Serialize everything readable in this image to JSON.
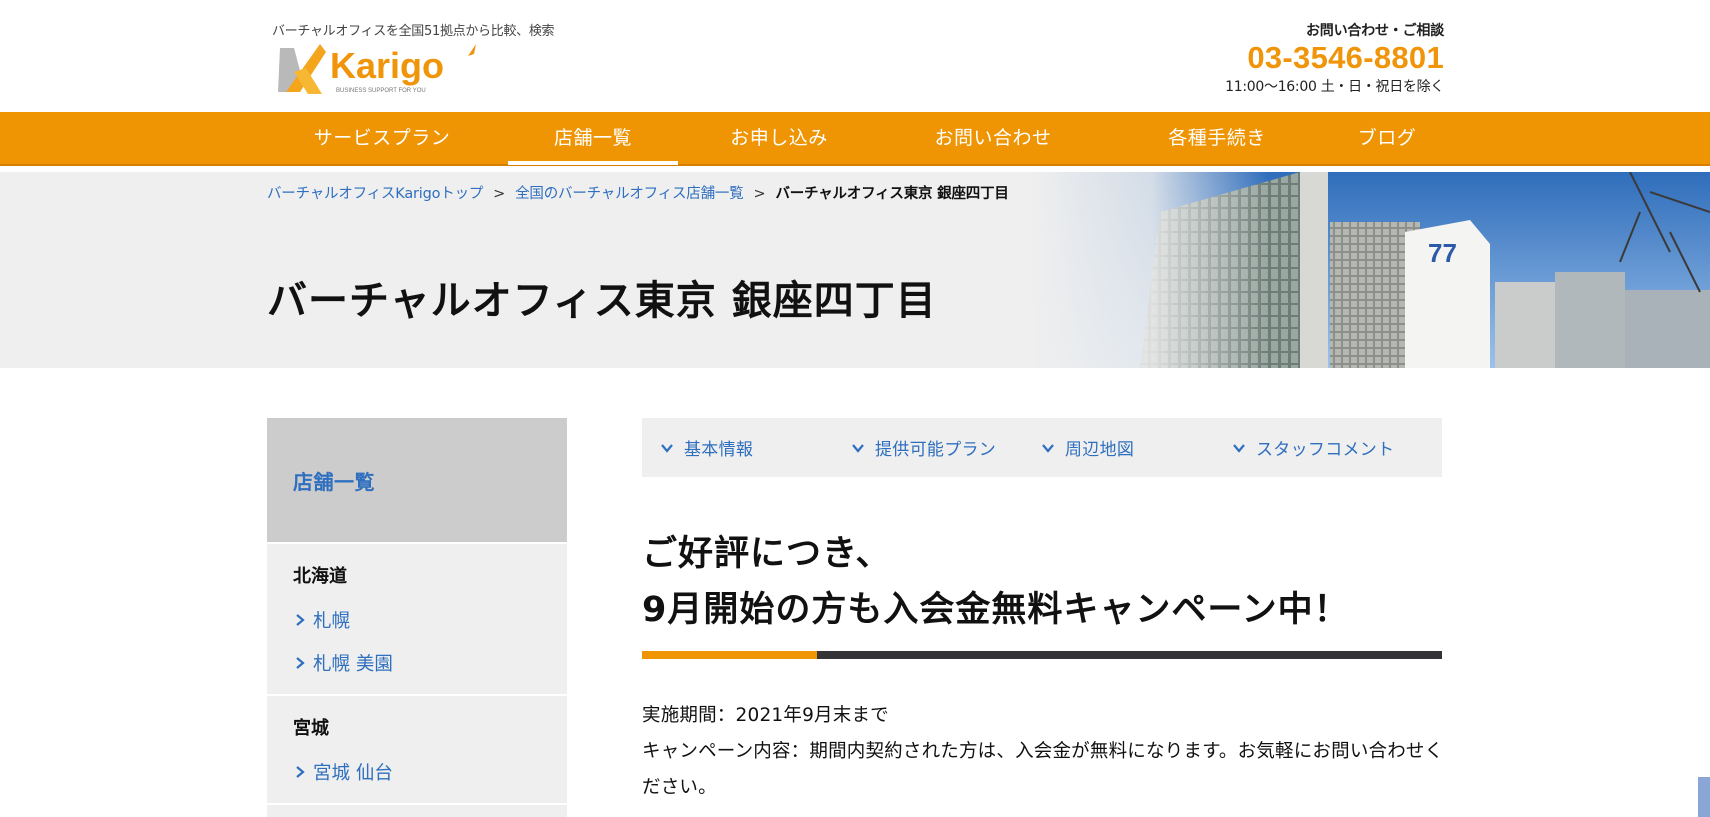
{
  "header": {
    "tagline": "バーチャルオフィスを全国51拠点から比較、検索",
    "logo_text": "Karigo",
    "logo_subtext": "BUSINESS SUPPORT FOR YOU",
    "contact_label": "お問い合わせ・ご相談",
    "phone": "03-3546-8801",
    "hours": "11:00〜16:00 土・日・祝日を除く"
  },
  "nav": {
    "items": [
      {
        "label": "サービスプラン"
      },
      {
        "label": "店舗一覧"
      },
      {
        "label": "お申し込み"
      },
      {
        "label": "お問い合わせ"
      },
      {
        "label": "各種手続き"
      },
      {
        "label": "ブログ"
      }
    ]
  },
  "breadcrumb": {
    "items": [
      "バーチャルオフィスKarigoトップ",
      "全国のバーチャルオフィス店舗一覧"
    ],
    "separator": ">",
    "current": "バーチャルオフィス東京 銀座四丁目"
  },
  "hero": {
    "title": "バーチャルオフィス東京 銀座四丁目"
  },
  "sidebar": {
    "heading": "店舗一覧",
    "regions": [
      {
        "name": "北海道",
        "stores": [
          "札幌",
          "札幌 美園"
        ]
      },
      {
        "name": "宮城",
        "stores": [
          "宮城 仙台"
        ]
      }
    ]
  },
  "tabs": {
    "items": [
      "基本情報",
      "提供可能プラン",
      "周辺地図",
      "スタッフコメント"
    ]
  },
  "campaign": {
    "title_line1": "ご好評につき、",
    "title_line2": "9月開始の方も入会金無料キャンペーン中！",
    "period": "実施期間：2021年9月末まで",
    "details": "キャンペーン内容：期間内契約された方は、入会金が無料になります。お気軽にお問い合わせください。"
  },
  "colors": {
    "accent_orange": "#ef9402",
    "link_blue": "#2f6fbf",
    "dark_bar": "#333338"
  }
}
